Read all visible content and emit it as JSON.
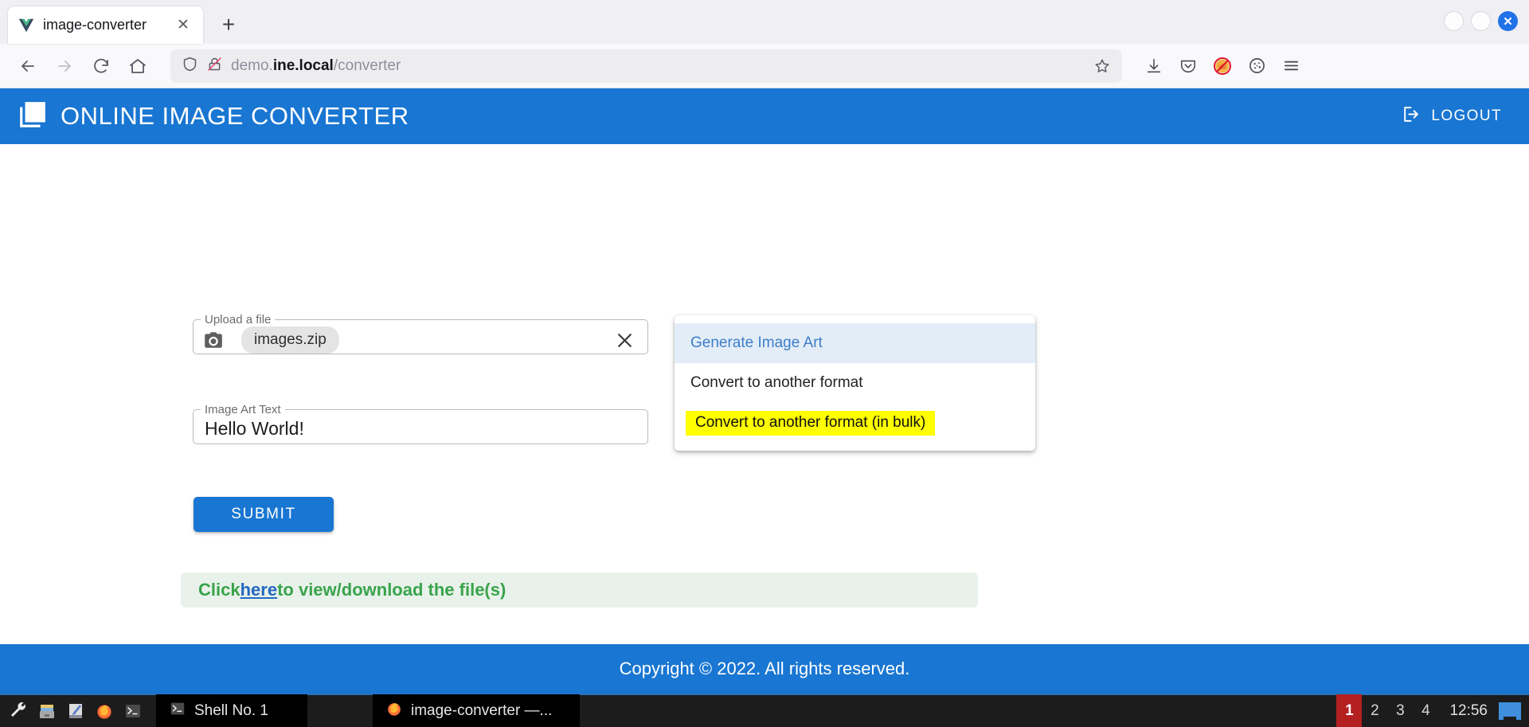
{
  "browser": {
    "tab": {
      "title": "image-converter",
      "favicon": "vue-logo-icon",
      "close_label": "✕"
    },
    "newtab_label": "+",
    "window_controls": {
      "minimize": "",
      "maximize": "",
      "close": "✕"
    },
    "nav": {
      "back": "←",
      "forward": "→",
      "reload": "↻",
      "home": "⌂"
    },
    "url": {
      "prefix": "demo.",
      "domain": "ine.local",
      "path": "/converter",
      "full": "demo.ine.local/converter"
    },
    "toolbar_icons": [
      "downloads-icon",
      "pocket-icon",
      "blocked-fox-icon",
      "cookie-icon",
      "hamburger-menu-icon"
    ]
  },
  "app": {
    "title": "ONLINE IMAGE CONVERTER",
    "logo": "photo-library-icon",
    "logout_label": "LOGOUT",
    "logout_icon": "exit-door-icon",
    "accent_color": "#1976d2"
  },
  "form": {
    "upload": {
      "legend": "Upload a file",
      "icon": "camera-icon",
      "filename": "images.zip",
      "clear_label": "✕"
    },
    "art_text": {
      "legend": "Image Art Text",
      "value": "Hello World!"
    },
    "submit_label": "SUBMIT"
  },
  "dropdown": {
    "items": [
      {
        "label": "Generate Image Art",
        "state": "selected"
      },
      {
        "label": "Convert to another format",
        "state": "normal"
      },
      {
        "label": "Convert to another format (in bulk)",
        "state": "highlighted"
      }
    ],
    "highlight_color": "#ffff00",
    "selected_color": "#3d7ec9"
  },
  "alert": {
    "prefix": "Click ",
    "link": "here",
    "suffix": " to view/download the file(s)",
    "text_color": "#3aa34c",
    "background": "#e8f2ea"
  },
  "footer": {
    "copyright": "Copyright © 2022. All rights reserved."
  },
  "taskbar": {
    "launchers": [
      "wrench-icon",
      "file-manager-icon",
      "text-editor-icon",
      "firefox-icon",
      "terminal-icon"
    ],
    "windows": [
      {
        "icon": "terminal-icon",
        "label": "Shell No. 1"
      },
      {
        "icon": "firefox-icon",
        "label": "image-converter —..."
      }
    ],
    "workspaces": [
      "1",
      "2",
      "3",
      "4"
    ],
    "active_workspace": "1",
    "clock": "12:56",
    "active_workspace_color": "#b42020"
  }
}
